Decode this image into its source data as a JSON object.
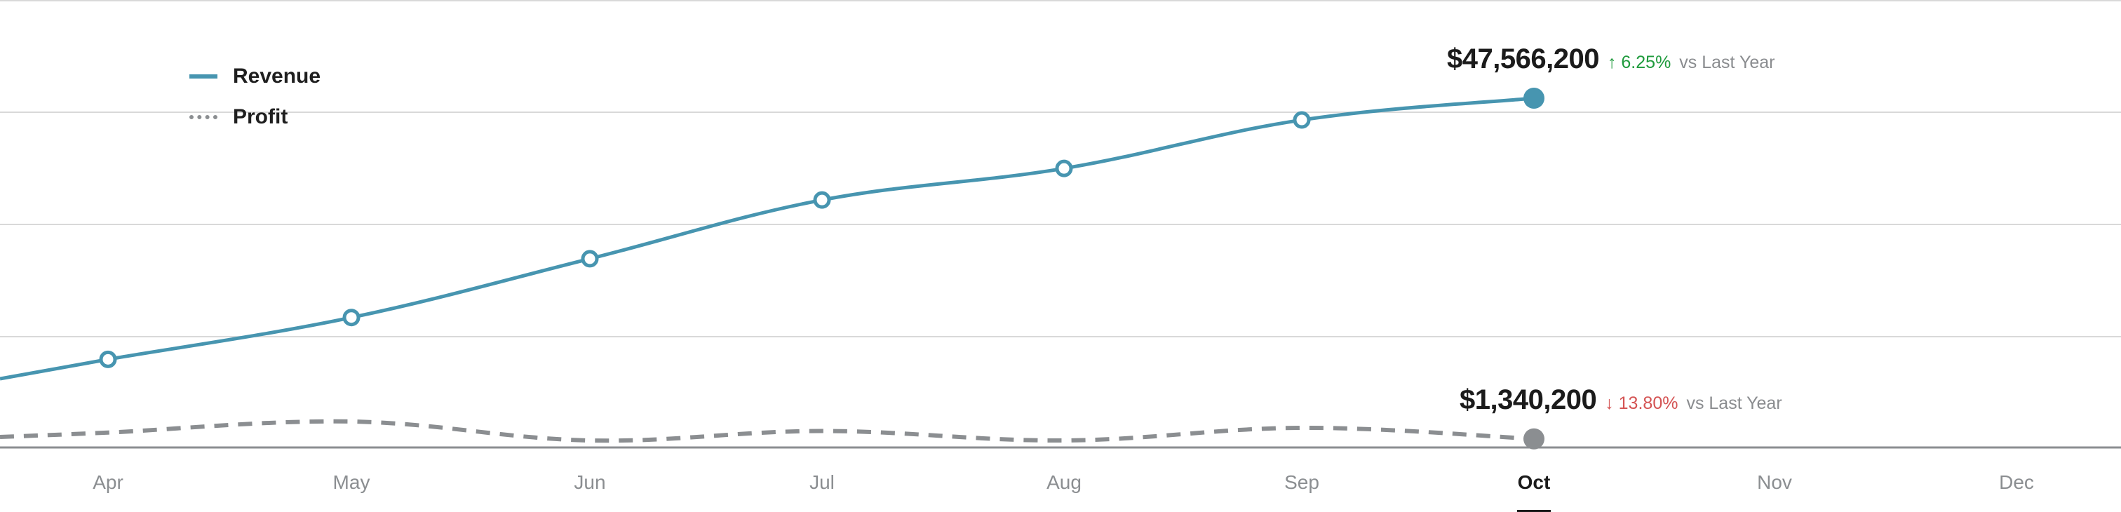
{
  "chart_data": {
    "type": "line",
    "title": "",
    "xlabel": "",
    "ylabel": "",
    "grid": true,
    "legend_position": "top-left",
    "categories": [
      "Apr",
      "May",
      "Jun",
      "Jul",
      "Aug",
      "Sep",
      "Oct",
      "Nov",
      "Dec"
    ],
    "active_category": "Oct",
    "series": [
      {
        "name": "Revenue",
        "style": "solid",
        "color": "#4795b0",
        "values": [
          12000000,
          17700000,
          25700000,
          33700000,
          38000000,
          44600000,
          47566200,
          null,
          null
        ],
        "latest_label": "$47,566,200",
        "change": {
          "direction": "up",
          "text": "6.25%",
          "suffix": "vs Last Year",
          "color": "#1e9a3c"
        }
      },
      {
        "name": "Profit",
        "style": "dashed",
        "color": "#8b8e91",
        "values": [
          1380000,
          1450000,
          1330000,
          1390000,
          1330000,
          1410000,
          1340200,
          null,
          null
        ],
        "latest_label": "$1,340,200",
        "change": {
          "direction": "down",
          "text": "13.80%",
          "suffix": "vs Last Year",
          "color": "#d45353"
        }
      }
    ],
    "revenue_axis_range": [
      0,
      50000000
    ],
    "profit_axis_range": [
      0,
      15000000
    ]
  },
  "legend": {
    "items": [
      {
        "label": "Revenue"
      },
      {
        "label": "Profit"
      }
    ]
  },
  "callouts": {
    "revenue": {
      "value": "$47,566,200",
      "arrow": "↑",
      "pct": "6.25%",
      "suffix": "vs Last Year"
    },
    "profit": {
      "value": "$1,340,200",
      "arrow": "↓",
      "pct": "13.80%",
      "suffix": "vs Last Year"
    }
  }
}
